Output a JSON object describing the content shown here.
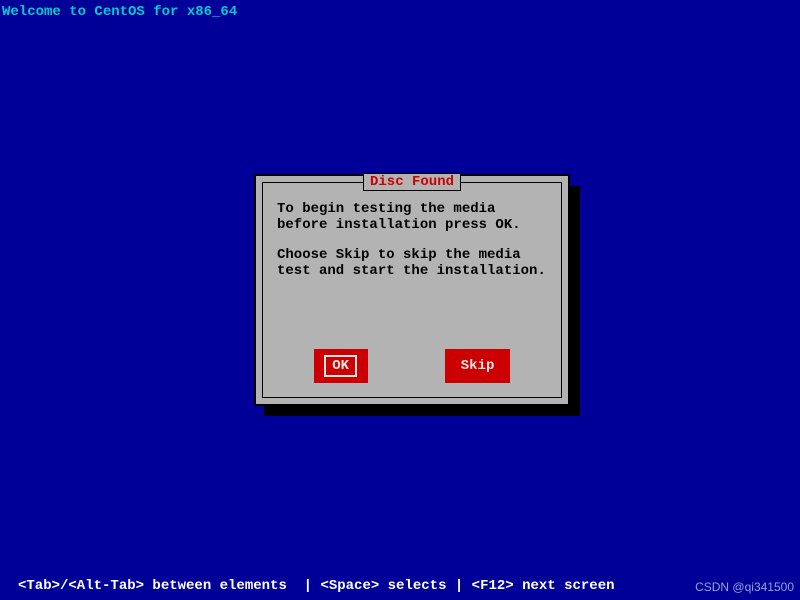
{
  "header": {
    "title": "Welcome to CentOS for x86_64"
  },
  "dialog": {
    "title": " Disc Found ",
    "para1": "To begin testing the media before installation press OK.",
    "para2": "Choose Skip to skip the media test and start the installation.",
    "buttons": {
      "ok": "OK",
      "skip": "Skip"
    }
  },
  "footer": {
    "help": "<Tab>/<Alt-Tab> between elements  | <Space> selects | <F12> next screen"
  },
  "watermark": "CSDN @qi341500"
}
